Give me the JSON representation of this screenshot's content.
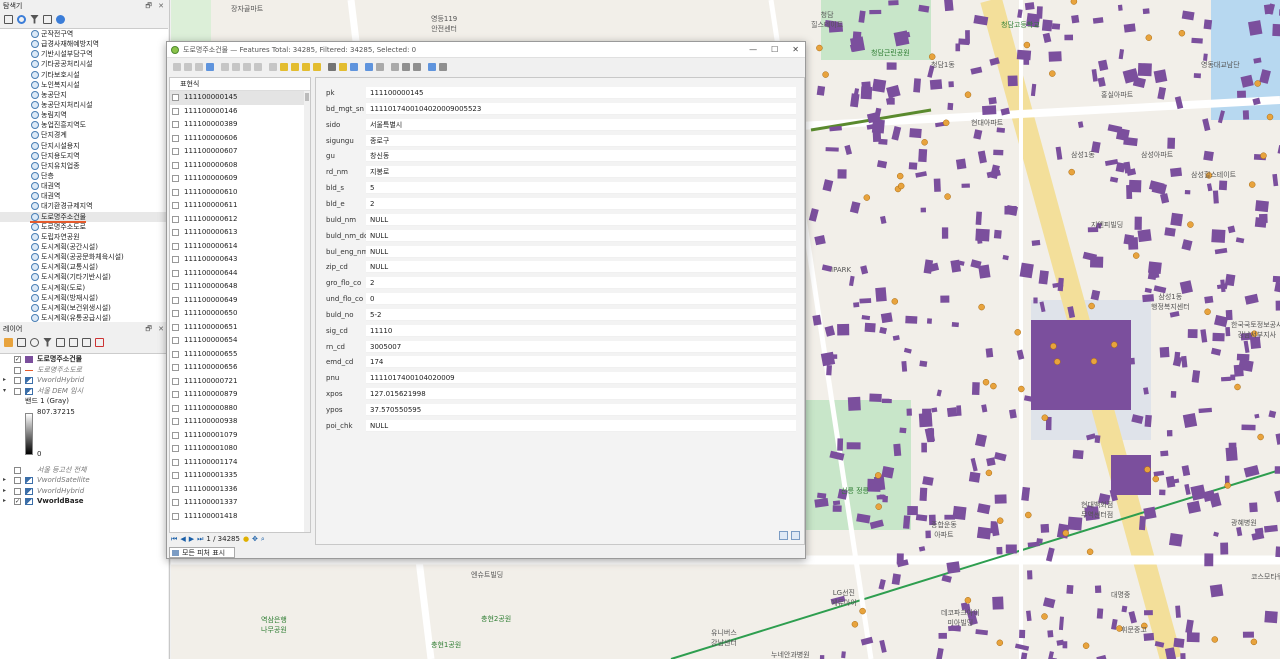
{
  "browser": {
    "title": "탐색기",
    "controls": "🗗 ✕",
    "items": [
      {
        "label": "군작전구역"
      },
      {
        "label": "급경사재해예방지역"
      },
      {
        "label": "기반시설부담구역"
      },
      {
        "label": "기타공공처리시설"
      },
      {
        "label": "기타보호시설"
      },
      {
        "label": "노인복지시설"
      },
      {
        "label": "농공단지"
      },
      {
        "label": "농공단지처리시설"
      },
      {
        "label": "농림지역"
      },
      {
        "label": "농업진흥지역도"
      },
      {
        "label": "단지경계"
      },
      {
        "label": "단지시설용지"
      },
      {
        "label": "단지용도지역"
      },
      {
        "label": "단지유치업종"
      },
      {
        "label": "단층"
      },
      {
        "label": "대권역"
      },
      {
        "label": "대권역"
      },
      {
        "label": "대기환경규제지역"
      },
      {
        "label": "도로명주소건물"
      },
      {
        "label": "도로명주소도로"
      },
      {
        "label": "도립자연공원"
      },
      {
        "label": "도시계획(공간시설)"
      },
      {
        "label": "도시계획(공공문화체육시설)"
      },
      {
        "label": "도시계획(교통시설)"
      },
      {
        "label": "도시계획(기타기반시설)"
      },
      {
        "label": "도시계획(도로)"
      },
      {
        "label": "도시계획(방재시설)"
      },
      {
        "label": "도시계획(보건위생시설)"
      },
      {
        "label": "도시계획(유통공급시설)"
      }
    ],
    "selected_index": 18
  },
  "layers": {
    "title": "레이어",
    "controls": "🗗 ✕",
    "items": [
      {
        "label": "도로명주소건물",
        "checked": true,
        "style": "bold",
        "arrow": "",
        "sym": "poly"
      },
      {
        "label": "도로명주소도로",
        "checked": false,
        "style": "ital",
        "arrow": "",
        "sym": "line"
      },
      {
        "label": "VworldHybrid",
        "checked": false,
        "style": "ital",
        "arrow": "▸",
        "sym": "raster"
      },
      {
        "label": "서울 DEM 임시",
        "checked": false,
        "style": "ital",
        "arrow": "▾",
        "sym": "raster"
      },
      {
        "label": "밴드 1 (Gray)",
        "checked": null,
        "style": "sub",
        "arrow": "",
        "sym": ""
      },
      {
        "label": "807.37215",
        "checked": null,
        "style": "sub",
        "arrow": "",
        "sym": ""
      },
      {
        "label": "0",
        "checked": null,
        "style": "zero",
        "arrow": "",
        "sym": ""
      },
      {
        "label": "서울 등고선 전체",
        "checked": false,
        "style": "ital",
        "arrow": "",
        "sym": ""
      },
      {
        "label": "VworldSatellite",
        "checked": false,
        "style": "ital",
        "arrow": "▸",
        "sym": "raster"
      },
      {
        "label": "VworldHybrid",
        "checked": false,
        "style": "ital",
        "arrow": "▸",
        "sym": "raster"
      },
      {
        "label": "VworldBase",
        "checked": true,
        "style": "bold",
        "arrow": "▸",
        "sym": "raster"
      }
    ]
  },
  "dialog": {
    "title": "도로명주소건물 — Features Total: 34285, Filtered: 34285, Selected: 0",
    "win_min": "—",
    "win_max": "☐",
    "win_close": "✕",
    "list_header": "표현식",
    "feature_ids": [
      "111100000145",
      "111100000146",
      "111100000389",
      "111100000606",
      "111100000607",
      "111100000608",
      "111100000609",
      "111100000610",
      "111100000611",
      "111100000612",
      "111100000613",
      "111100000614",
      "111100000643",
      "111100000644",
      "111100000648",
      "111100000649",
      "111100000650",
      "111100000651",
      "111100000654",
      "111100000655",
      "111100000656",
      "111100000721",
      "111100000879",
      "111100000880",
      "111100000938",
      "111100001079",
      "111100001080",
      "111100001174",
      "111100001335",
      "111100001336",
      "111100001337",
      "111100001418"
    ],
    "nav_position": "1 / 34285",
    "show_all_label": "모든 피처 표시",
    "fields": [
      {
        "key": "pk",
        "value": "111100000145"
      },
      {
        "key": "bd_mgt_sn",
        "value": "1111017400104020009005523"
      },
      {
        "key": "sido",
        "value": "서울특별시"
      },
      {
        "key": "sigungu",
        "value": "종로구"
      },
      {
        "key": "gu",
        "value": "창신동"
      },
      {
        "key": "rd_nm",
        "value": "지봉로"
      },
      {
        "key": "bld_s",
        "value": "5"
      },
      {
        "key": "bld_e",
        "value": "2"
      },
      {
        "key": "buld_nm",
        "value": "NULL"
      },
      {
        "key": "buld_nm_dc",
        "value": "NULL"
      },
      {
        "key": "bul_eng_nm",
        "value": "NULL"
      },
      {
        "key": "zip_cd",
        "value": "NULL"
      },
      {
        "key": "gro_flo_co",
        "value": "2"
      },
      {
        "key": "und_flo_co",
        "value": "0"
      },
      {
        "key": "buld_no",
        "value": "5-2"
      },
      {
        "key": "sig_cd",
        "value": "11110"
      },
      {
        "key": "rn_cd",
        "value": "3005007"
      },
      {
        "key": "emd_cd",
        "value": "174"
      },
      {
        "key": "pnu",
        "value": "1111017400104020009"
      },
      {
        "key": "xpos",
        "value": "127.015621998"
      },
      {
        "key": "ypos",
        "value": "37.570550595"
      },
      {
        "key": "poi_chk",
        "value": "NULL"
      }
    ]
  },
  "map": {
    "labels": [
      {
        "text": "장자골마트",
        "cls": ""
      },
      {
        "text": "영등119\n안전센터",
        "cls": ""
      },
      {
        "text": "청담\n힐스테이트",
        "cls": ""
      },
      {
        "text": "청담1동",
        "cls": ""
      },
      {
        "text": "청담고등학교",
        "cls": "green"
      },
      {
        "text": "청담근린공원",
        "cls": "green"
      },
      {
        "text": "현대아파트",
        "cls": ""
      },
      {
        "text": "삼성1동",
        "cls": ""
      },
      {
        "text": "지엔피빌딩",
        "cls": ""
      },
      {
        "text": "IPARK",
        "cls": ""
      },
      {
        "text": "삼성1동\n행정복지센터",
        "cls": ""
      },
      {
        "text": "한국국토정보공사\n강남서부지사",
        "cls": ""
      },
      {
        "text": "선릉 정릉",
        "cls": "green"
      },
      {
        "text": "종합운동\n아파트",
        "cls": ""
      },
      {
        "text": "현대백화점\n무역센터점",
        "cls": ""
      },
      {
        "text": "광혜병원",
        "cls": ""
      },
      {
        "text": "코스모타워",
        "cls": ""
      },
      {
        "text": "엔슈트빌딩",
        "cls": ""
      },
      {
        "text": "역삼은행\n나무공원",
        "cls": "green"
      },
      {
        "text": "충현1공원",
        "cls": "green"
      },
      {
        "text": "충현2공원",
        "cls": "green"
      },
      {
        "text": "LG선진\n에듀아이",
        "cls": ""
      },
      {
        "text": "데코파크아이\n미아빌딩",
        "cls": ""
      },
      {
        "text": "휘문중고",
        "cls": ""
      },
      {
        "text": "대명중",
        "cls": ""
      },
      {
        "text": "누네안과병원",
        "cls": ""
      },
      {
        "text": "유니버스\n강남센터",
        "cls": ""
      },
      {
        "text": "영동대교남단",
        "cls": ""
      },
      {
        "text": "홍실아파트",
        "cls": ""
      },
      {
        "text": "삼성아파트",
        "cls": ""
      },
      {
        "text": "삼성힐스테이트",
        "cls": ""
      }
    ]
  },
  "colors": {
    "building": "#7b4f9d",
    "road_major": "#f3df9a",
    "road_minor": "#ffffff",
    "park": "#c8e6c9",
    "subway": "#2e9e4f",
    "accent": "#e55a2b"
  }
}
